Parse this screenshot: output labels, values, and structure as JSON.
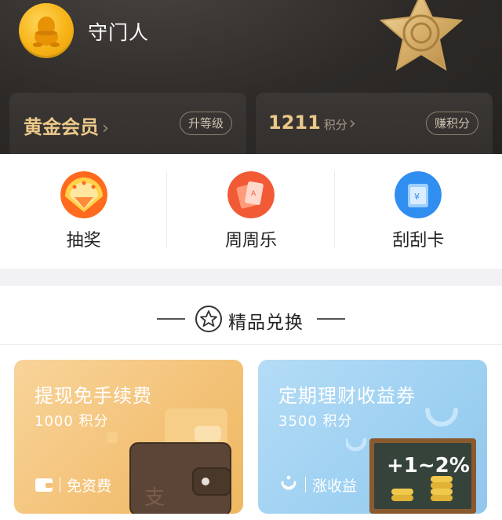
{
  "header": {
    "username": "守门人",
    "member_card": {
      "level": "黄金会员",
      "chevron": "›",
      "action": "升等级"
    },
    "points_card": {
      "points": "1211",
      "unit": "积分",
      "chevron": "›",
      "action": "赚积分"
    }
  },
  "shortcuts": [
    {
      "label": "抽奖",
      "icon": "lottery-fan-icon",
      "color": "#f6641f"
    },
    {
      "label": "周周乐",
      "icon": "playing-cards-icon",
      "color": "#f05a3a"
    },
    {
      "label": "刮刮卡",
      "icon": "scratch-card-icon",
      "color": "#2f8ef0"
    }
  ],
  "section": {
    "title": "精品兑换",
    "icon": "star-icon"
  },
  "promos": [
    {
      "title": "提现免手续费",
      "points": "1000 积分",
      "tag": "免资费",
      "tag_icon": "wallet-icon",
      "image": "wallet-illustration",
      "color": "#f3c176"
    },
    {
      "title": "定期理财收益券",
      "points": "3500 积分",
      "tag": "涨收益",
      "tag_icon": "smile-coin-icon",
      "image": "chalkboard-illustration",
      "board_text": "+1~2%",
      "color": "#9dd0f1"
    }
  ]
}
